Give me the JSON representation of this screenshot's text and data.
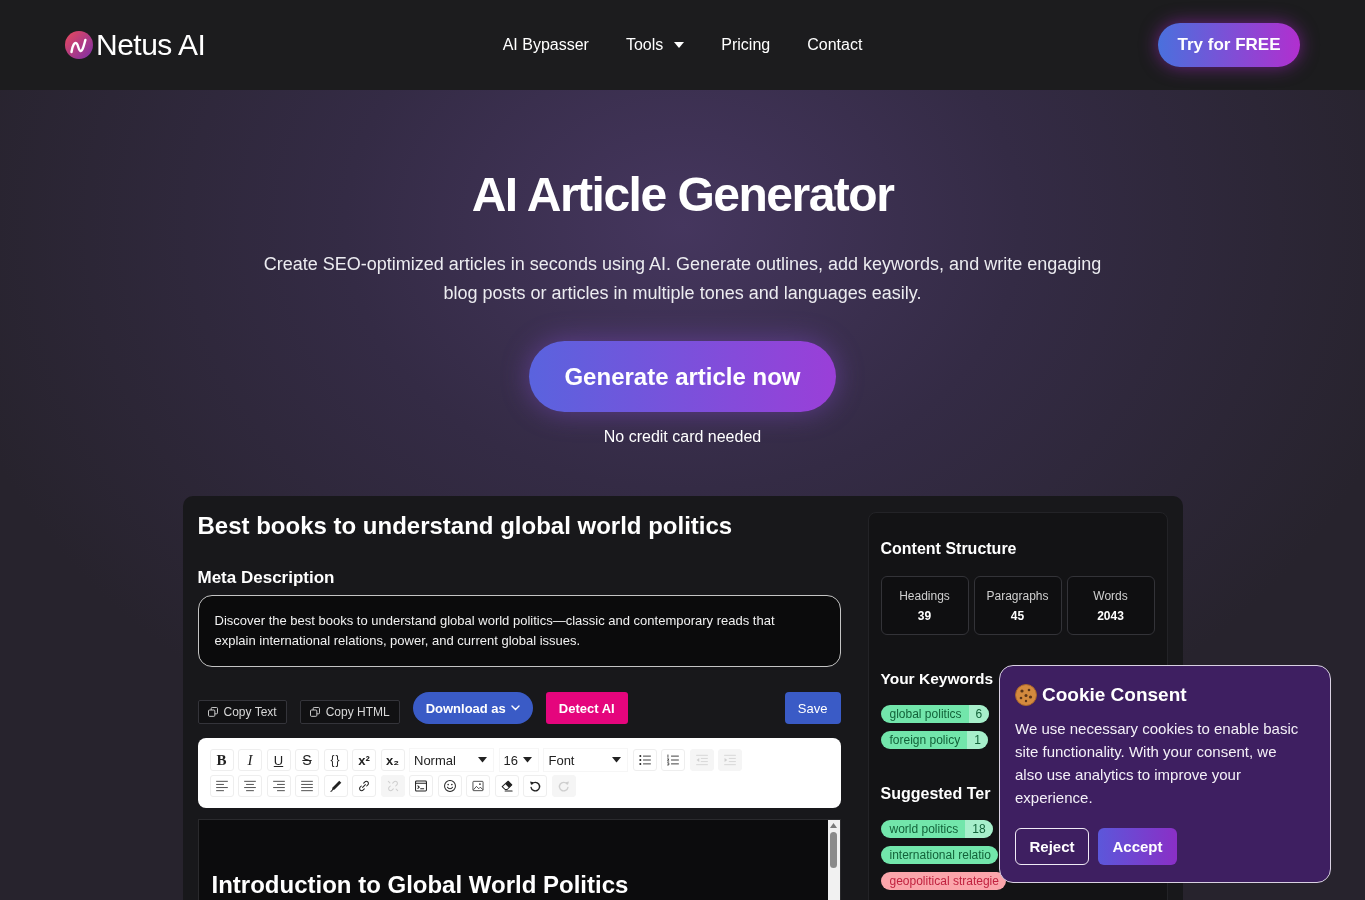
{
  "header": {
    "logo": "Netus AI",
    "links": [
      {
        "label": "AI Bypasser",
        "dropdown": false
      },
      {
        "label": "Tools",
        "dropdown": true
      },
      {
        "label": "Pricing",
        "dropdown": false
      },
      {
        "label": "Contact",
        "dropdown": false
      }
    ],
    "cta": "Try for FREE"
  },
  "hero": {
    "title": "AI Article Generator",
    "description": "Create SEO-optimized articles in seconds using AI. Generate outlines, add keywords, and write engaging blog posts or articles in multiple tones and languages easily.",
    "button": "Generate article now",
    "note": "No credit card needed"
  },
  "article": {
    "title": "Best books to understand global world politics",
    "meta_label": "Meta Description",
    "meta_value": "Discover the best books to understand global world politics—classic and contemporary reads that explain international relations, power, and current global issues.",
    "actions": [
      {
        "label": "Copy Text",
        "kind": "copy"
      },
      {
        "label": "Copy HTML",
        "kind": "copy"
      },
      {
        "label": "Download as",
        "kind": "dropdown"
      },
      {
        "label": "Detect AI",
        "kind": "detect"
      },
      {
        "label": "Save",
        "kind": "save"
      }
    ],
    "toolbar": {
      "rows": [
        {
          "items": [
            {
              "kind": "bold",
              "label": "B",
              "disabled": false
            },
            {
              "kind": "italic",
              "label": "I",
              "disabled": false
            },
            {
              "kind": "underline",
              "label": "U",
              "disabled": false
            },
            {
              "kind": "strike",
              "label": "S",
              "disabled": false
            },
            {
              "kind": "code",
              "label": "{}",
              "disabled": false
            },
            {
              "kind": "superscript",
              "label": "x²",
              "disabled": false
            },
            {
              "kind": "subscript",
              "label": "x₂",
              "disabled": false
            },
            {
              "kind": "select",
              "label": "Normal",
              "disabled": false
            },
            {
              "kind": "select",
              "label": "16",
              "disabled": false
            },
            {
              "kind": "select",
              "label": "Font",
              "disabled": false
            },
            {
              "kind": "bullets",
              "disabled": false
            },
            {
              "kind": "numbered",
              "disabled": false
            },
            {
              "kind": "outdent",
              "disabled": true
            },
            {
              "kind": "indent",
              "disabled": true
            }
          ]
        },
        {
          "items": [
            {
              "kind": "alignleft",
              "disabled": false
            },
            {
              "kind": "aligncenter",
              "disabled": false
            },
            {
              "kind": "alignright",
              "disabled": false
            },
            {
              "kind": "justify",
              "disabled": false
            },
            {
              "kind": "pen",
              "disabled": false
            },
            {
              "kind": "link",
              "disabled": false
            },
            {
              "kind": "unlink",
              "disabled": true
            },
            {
              "kind": "embed",
              "disabled": false
            },
            {
              "kind": "emoji",
              "disabled": false
            },
            {
              "kind": "image",
              "disabled": false
            },
            {
              "kind": "eraser",
              "disabled": false
            },
            {
              "kind": "undo",
              "disabled": false
            },
            {
              "kind": "redo",
              "disabled": true
            }
          ]
        }
      ]
    },
    "editor": {
      "heading": "Introduction to Global World Politics"
    }
  },
  "sidebar": {
    "structure": {
      "title": "Content Structure",
      "stats": [
        {
          "label": "Headings",
          "value": "39"
        },
        {
          "label": "Paragraphs",
          "value": "45"
        },
        {
          "label": "Words",
          "value": "2043"
        }
      ]
    },
    "keywords": {
      "title": "Your Keywords",
      "items": [
        {
          "term": "global politics",
          "count": "6",
          "color": "#72e6ab"
        },
        {
          "term": "foreign policy",
          "count": "1",
          "color": "#72e6ab"
        }
      ]
    },
    "suggested": {
      "title": "Suggested Ter",
      "items": [
        {
          "term": "world politics",
          "count": "18",
          "color": "#72e6ab"
        },
        {
          "term": "international relatio",
          "color": "#72e6ab"
        },
        {
          "term": "geopolitical strategie",
          "color": "#fba5ab"
        }
      ]
    }
  },
  "cookie_consent": {
    "title": "Cookie Consent",
    "text": "We use necessary cookies to enable basic site functionality. With your consent, we also use analytics to improve your experience.",
    "buttons": [
      {
        "label": "Reject",
        "kind": "outline"
      },
      {
        "label": "Accept",
        "kind": "primary"
      }
    ]
  }
}
